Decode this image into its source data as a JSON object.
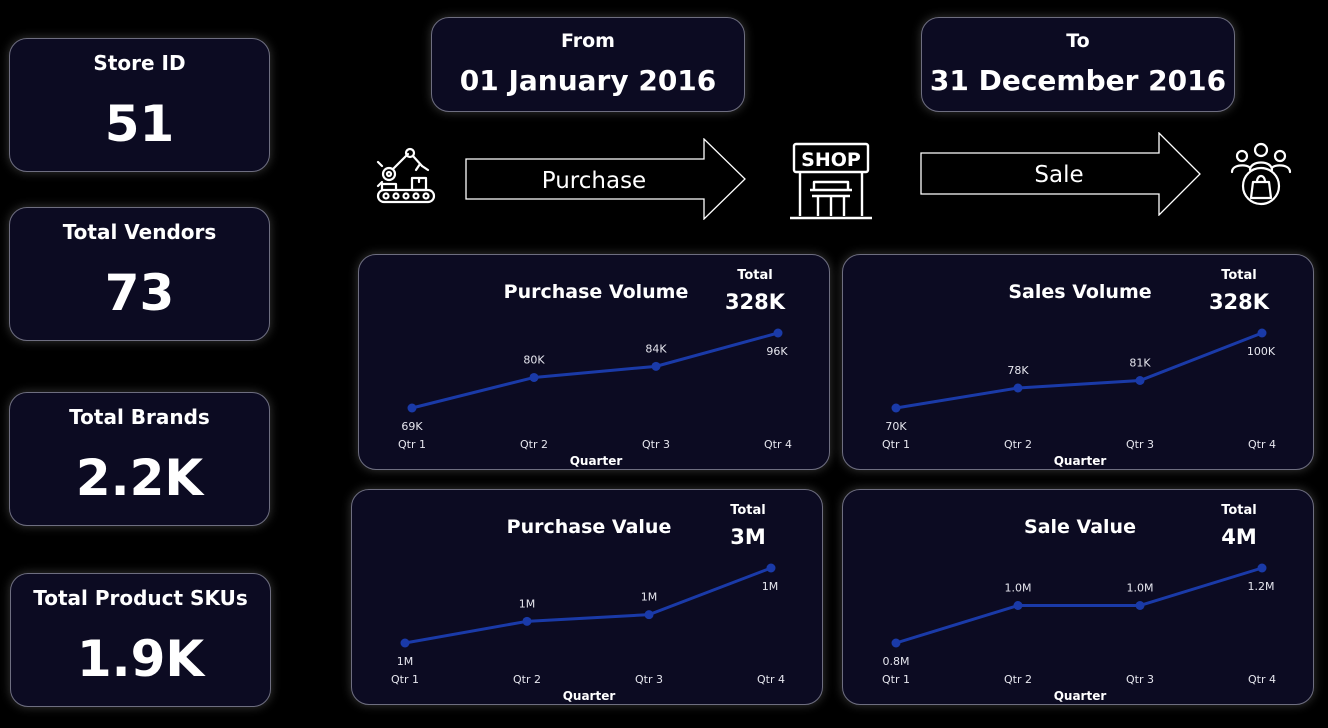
{
  "kpis": {
    "store_id": {
      "label": "Store ID",
      "value": "51"
    },
    "total_vendors": {
      "label": "Total Vendors",
      "value": "73"
    },
    "total_brands": {
      "label": "Total Brands",
      "value": "2.2K"
    },
    "total_skus": {
      "label": "Total Product SKUs",
      "value": "1.9K"
    }
  },
  "date_range": {
    "from_label": "From",
    "from_value": "01 January 2016",
    "to_label": "To",
    "to_value": "31 December 2016"
  },
  "flow": {
    "purchase_label": "Purchase",
    "sale_label": "Sale",
    "shop_sign": "SHOP",
    "icons": [
      "factory-robot-icon",
      "shop-icon",
      "customers-bag-icon"
    ]
  },
  "colors": {
    "line": "#1a3aa8",
    "card_bg": "#0c0b22",
    "card_border": "#6e6e80"
  },
  "chart_data": [
    {
      "id": "purchase_volume",
      "type": "line",
      "title": "Purchase Volume",
      "total_label": "Total",
      "total_value": "328K",
      "xlabel": "Quarter",
      "categories": [
        "Qtr 1",
        "Qtr 2",
        "Qtr 3",
        "Qtr 4"
      ],
      "values": [
        69000,
        80000,
        84000,
        96000
      ],
      "data_labels": [
        "69K",
        "80K",
        "84K",
        "96K"
      ]
    },
    {
      "id": "sales_volume",
      "type": "line",
      "title": "Sales Volume",
      "total_label": "Total",
      "total_value": "328K",
      "xlabel": "Quarter",
      "categories": [
        "Qtr 1",
        "Qtr 2",
        "Qtr 3",
        "Qtr 4"
      ],
      "values": [
        70000,
        78000,
        81000,
        100000
      ],
      "data_labels": [
        "70K",
        "78K",
        "81K",
        "100K"
      ]
    },
    {
      "id": "purchase_value",
      "type": "line",
      "title": "Purchase Value",
      "total_label": "Total",
      "total_value": "3M",
      "xlabel": "Quarter",
      "categories": [
        "Qtr 1",
        "Qtr 2",
        "Qtr 3",
        "Qtr 4"
      ],
      "values": [
        0.6,
        0.73,
        0.77,
        1.05
      ],
      "data_labels": [
        "1M",
        "1M",
        "1M",
        "1M"
      ]
    },
    {
      "id": "sale_value",
      "type": "line",
      "title": "Sale Value",
      "total_label": "Total",
      "total_value": "4M",
      "xlabel": "Quarter",
      "categories": [
        "Qtr 1",
        "Qtr 2",
        "Qtr 3",
        "Qtr 4"
      ],
      "values": [
        0.8,
        1.0,
        1.0,
        1.2
      ],
      "data_labels": [
        "0.8M",
        "1.0M",
        "1.0M",
        "1.2M"
      ]
    }
  ]
}
